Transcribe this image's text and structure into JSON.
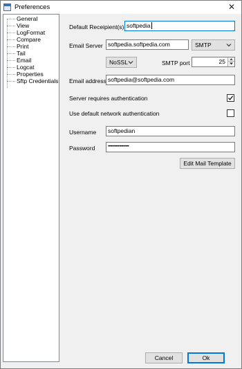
{
  "window": {
    "title": "Preferences"
  },
  "tree": {
    "items": [
      "General",
      "View",
      "LogFormat",
      "Compare",
      "Print",
      "Tail",
      "Email",
      "Logcat",
      "Properties",
      "Sftp Credentials"
    ]
  },
  "email": {
    "default_recipient_label": "Default Receipient(s)",
    "default_recipient_value": "softpedia",
    "email_server_label": "Email Server",
    "email_server_value": "softpedia.softpedia.com",
    "protocol_value": "SMTP",
    "ssl_value": "NoSSL",
    "smtp_port_label": "SMTP port",
    "smtp_port_value": "25",
    "email_address_label": "Email address",
    "email_address_value": "softpedia@softpedia.com",
    "requires_auth_label": "Server requires authentication",
    "requires_auth_checked": true,
    "default_network_auth_label": "Use default network authentication",
    "default_network_auth_checked": false,
    "username_label": "Username",
    "username_value": "softpedian",
    "password_label": "Password",
    "password_value": "•••••••••••••••••••",
    "edit_template_label": "Edit Mail Template"
  },
  "footer": {
    "cancel_label": "Cancel",
    "ok_label": "Ok"
  }
}
